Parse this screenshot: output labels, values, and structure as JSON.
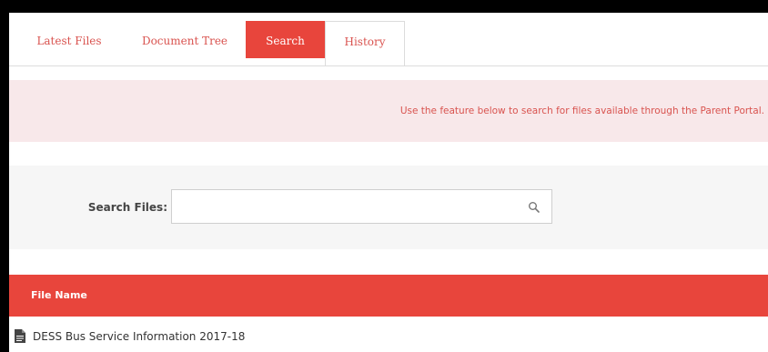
{
  "tabs": [
    {
      "label": "Latest Files",
      "active": false
    },
    {
      "label": "Document Tree",
      "active": false
    },
    {
      "label": "Search",
      "active": true
    },
    {
      "label": "History",
      "active": false
    }
  ],
  "info_banner": {
    "text": "Use the feature below to search for files available through the Parent Portal."
  },
  "search": {
    "label": "Search Files:",
    "value": "",
    "placeholder": "",
    "icon": "search-icon"
  },
  "table": {
    "headers": [
      "File Name"
    ],
    "rows": [
      {
        "icon": "file-icon",
        "file_name": "DESS Bus Service Information 2017-18"
      }
    ]
  },
  "colors": {
    "accent": "#e8453c",
    "banner_bg": "#f8e8ea",
    "link_text": "#d9534f",
    "panel_bg": "#f6f6f6"
  }
}
